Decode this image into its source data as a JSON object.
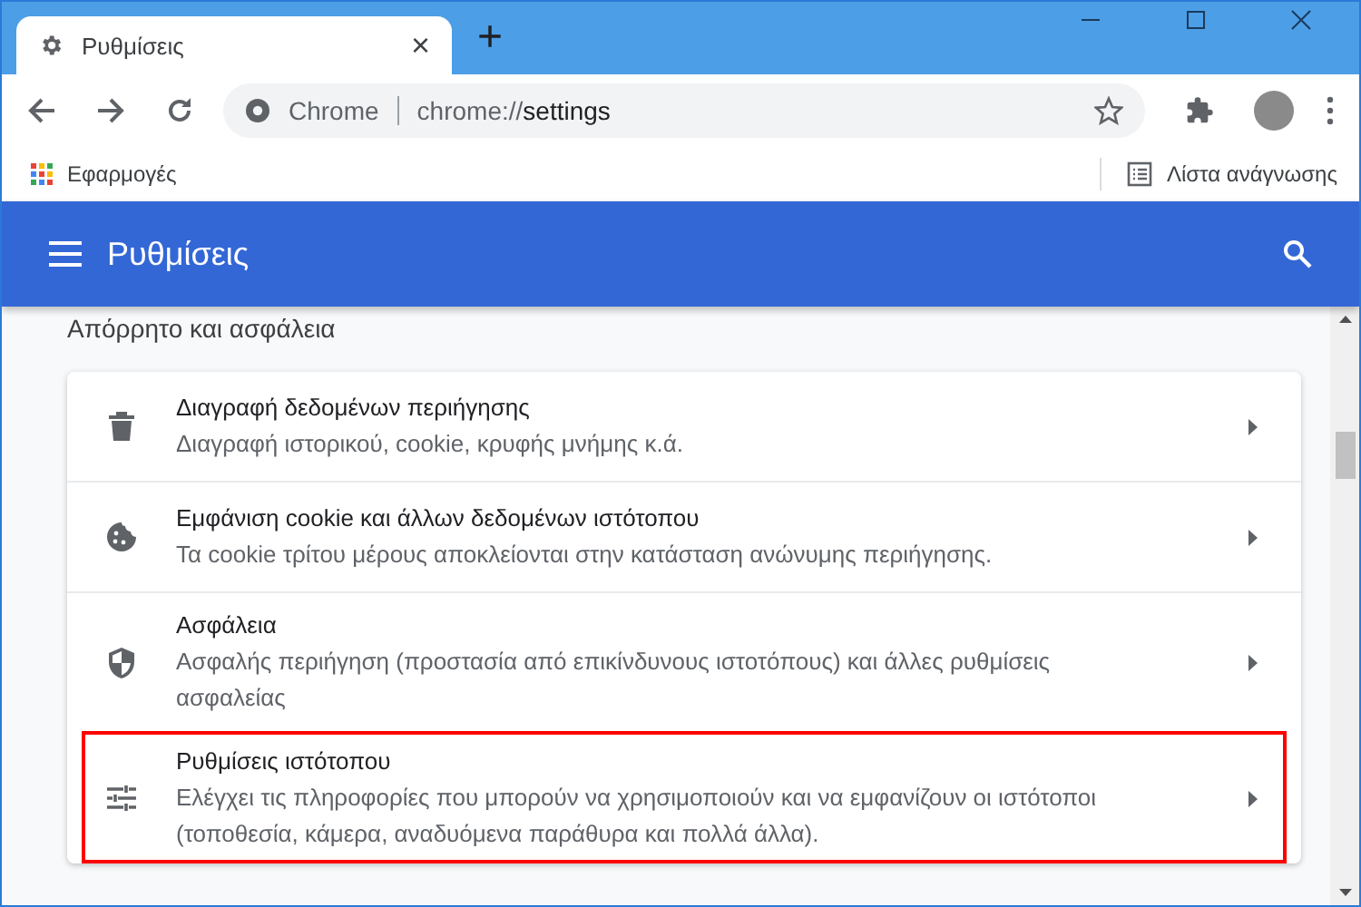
{
  "tab": {
    "title": "Ρυθμίσεις",
    "close": "×"
  },
  "new_tab": "+",
  "address": {
    "site": "Chrome",
    "scheme": "chrome://",
    "path": "settings"
  },
  "bookmarks": {
    "apps": "Εφαρμογές",
    "reading_list": "Λίστα ανάγνωσης"
  },
  "header": {
    "title": "Ρυθμίσεις"
  },
  "section": {
    "title": "Απόρρητο και ασφάλεια"
  },
  "items": [
    {
      "kind": "trash",
      "title": "Διαγραφή δεδομένων περιήγησης",
      "description": "Διαγραφή ιστορικού, cookie, κρυφής μνήμης κ.ά.",
      "highlighted": false
    },
    {
      "kind": "cookie",
      "title": "Εμφάνιση cookie και άλλων δεδομένων ιστότοπου",
      "description": "Τα cookie τρίτου μέρους αποκλείονται στην κατάσταση ανώνυμης περιήγησης.",
      "highlighted": false
    },
    {
      "kind": "shield",
      "title": "Ασφάλεια",
      "description": "Ασφαλής περιήγηση (προστασία από επικίνδυνους ιστοτόπους) και άλλες ρυθμίσεις ασφαλείας",
      "highlighted": false
    },
    {
      "kind": "sliders",
      "title": "Ρυθμίσεις ιστότοπου",
      "description": "Ελέγχει τις πληροφορίες που μπορούν να χρησιμοποιούν και να εμφανίζουν οι ιστότοποι (τοποθεσία, κάμερα, αναδυόμενα παράθυρα και πολλά άλλα).",
      "highlighted": true
    }
  ]
}
